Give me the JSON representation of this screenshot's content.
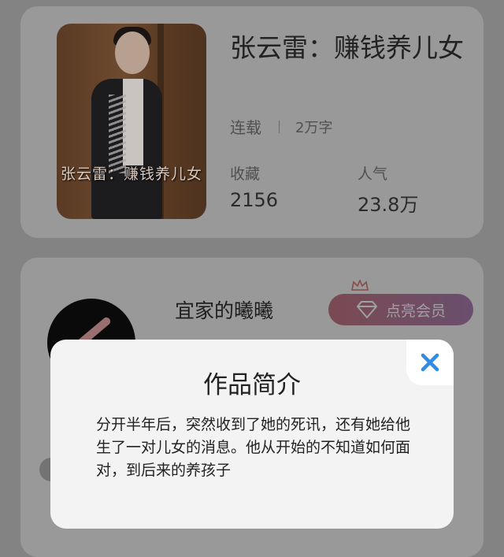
{
  "book": {
    "title": "张云雷：赚钱养儿女",
    "cover_text": "张云雷：赚钱养儿女",
    "status": "连载",
    "word_count": "2万字",
    "favorites_label": "收藏",
    "favorites_value": "2156",
    "popularity_label": "人气",
    "popularity_value": "23.8万"
  },
  "author": {
    "name": "宜家的曦曦",
    "vip_button_label": "点亮会员"
  },
  "modal": {
    "title": "作品简介",
    "body": "分开半年后，突然收到了她的死讯，还有她给他生了一对儿女的消息。他从开始的不知道如何面对，到后来的养孩子"
  },
  "icons": {
    "close": "close-icon",
    "vip": "diamond-icon",
    "crown": "crown-icon"
  },
  "colors": {
    "accent_blue": "#2f8be6",
    "vip_gradient_start": "#7a4a52",
    "vip_gradient_end": "#6a4f6e"
  }
}
